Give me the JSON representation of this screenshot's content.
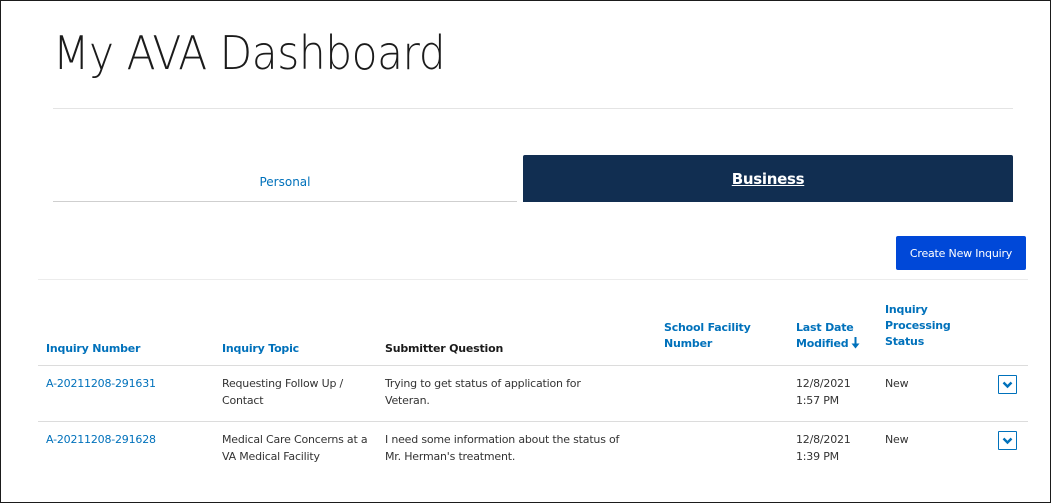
{
  "page": {
    "title": "My AVA Dashboard"
  },
  "tabs": {
    "personal": "Personal",
    "business": "Business"
  },
  "toolbar": {
    "create_label": "Create New Inquiry"
  },
  "table": {
    "headers": {
      "inquiry_number": "Inquiry Number",
      "inquiry_topic": "Inquiry Topic",
      "submitter_question": "Submitter Question",
      "school_facility_1": "School Facility",
      "school_facility_2": "Number",
      "last_modified_1": "Last Date",
      "last_modified_2": "Modified",
      "status_1": "Inquiry",
      "status_2": "Processing",
      "status_3": "Status"
    },
    "rows": [
      {
        "number": "A-20211208-291631",
        "topic_1": "Requesting Follow Up /",
        "topic_2": "Contact",
        "question_1": "Trying to get status of application for",
        "question_2": "Veteran.",
        "facility": "",
        "date": "12/8/2021",
        "time": "1:57 PM",
        "status": "New"
      },
      {
        "number": "A-20211208-291628",
        "topic_1": "Medical Care Concerns at a",
        "topic_2": "VA Medical Facility",
        "question_1": "I need some information about the status of",
        "question_2": "Mr. Herman's treatment.",
        "facility": "",
        "date": "12/8/2021",
        "time": "1:39 PM",
        "status": "New"
      }
    ]
  },
  "colors": {
    "accent": "#0071bb",
    "business_tab": "#112e51",
    "button": "#0048d8"
  },
  "icons": {
    "sort": "arrow-down-icon",
    "expand": "chevron-down-icon"
  }
}
